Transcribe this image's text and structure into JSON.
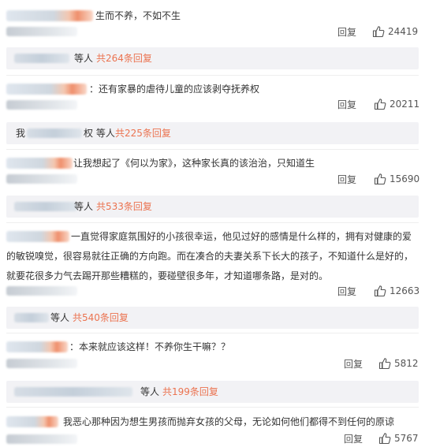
{
  "comments": [
    {
      "text": "生而不养，不如不生",
      "reply_label": "回复",
      "like_count": "24419",
      "sub_others": "等人",
      "sub_link": "共264条回复"
    },
    {
      "text": "：还有家暴的虐待儿童的应该剥夺抚养权",
      "reply_label": "回复",
      "like_count": "20211",
      "sub_prefix": "我",
      "sub_others": "权 等人",
      "sub_link": "共225条回复"
    },
    {
      "text": "让我想起了《何以为家》，这种家长真的该治治，只知道生",
      "reply_label": "回复",
      "like_count": "15690",
      "sub_others": "等人",
      "sub_link": "共533条回复"
    },
    {
      "text_lines": [
        "一直觉得家庭氛围好的小孩很幸运，他见过好的感情是什么样的，拥有对健康的爱",
        "的敏锐嗅觉，很容易就往正确的方向跑。而在凑合的夫妻关系下长大的孩子，不知道什么是好的，",
        "就要花很多力气去踢开那些糟糕的，要碰壁很多年，才知道哪条路，是对的。"
      ],
      "reply_label": "回复",
      "like_count": "12663",
      "sub_others": "等人",
      "sub_link": "共540条回复"
    },
    {
      "text": "：本来就应该这样！不养你生干嘛？？",
      "reply_label": "回复",
      "like_count": "5812",
      "sub_others": "等人",
      "sub_link": "共199条回复"
    },
    {
      "text": "我恶心那种因为想生男孩而抛弃女孩的父母，无论如何他们都得不到任何的原谅",
      "reply_label": "回复",
      "like_count": "5767"
    }
  ],
  "icons": {
    "like": "thumbs-up-icon"
  },
  "colors": {
    "link": "#eb7350",
    "sub_bar_bg": "#f2f2f5",
    "text": "#333333"
  }
}
